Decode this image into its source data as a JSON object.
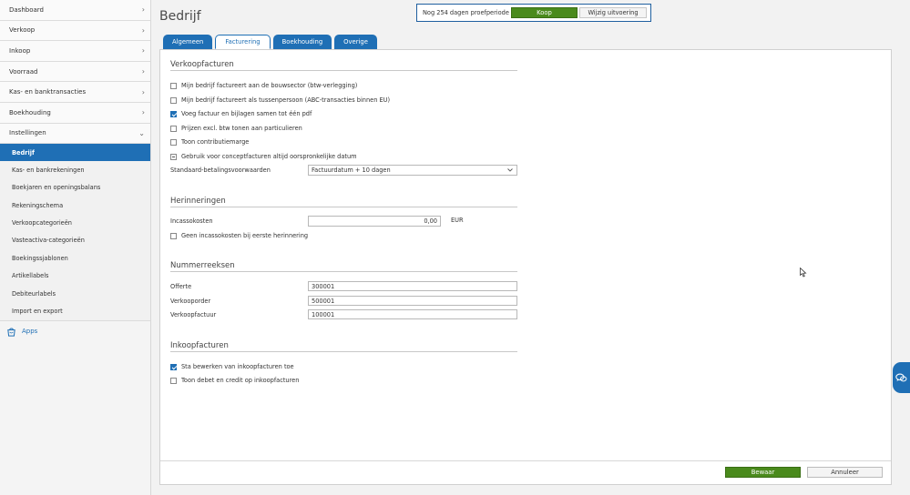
{
  "sidebar": {
    "nav": [
      {
        "label": "Dashboard"
      },
      {
        "label": "Verkoop"
      },
      {
        "label": "Inkoop"
      },
      {
        "label": "Voorraad"
      },
      {
        "label": "Kas- en banktransacties"
      },
      {
        "label": "Boekhouding"
      },
      {
        "label": "Instellingen"
      }
    ],
    "settings_items": [
      {
        "label": "Bedrijf"
      },
      {
        "label": "Kas- en bankrekeningen"
      },
      {
        "label": "Boekjaren en openingsbalans"
      },
      {
        "label": "Rekeningschema"
      },
      {
        "label": "Verkoopcategorieën"
      },
      {
        "label": "Vasteactiva-categorieën"
      },
      {
        "label": "Boekingssjablonen"
      },
      {
        "label": "Artikellabels"
      },
      {
        "label": "Debiteurlabels"
      },
      {
        "label": "Import en export"
      }
    ],
    "apps_label": "Apps"
  },
  "page": {
    "title": "Bedrijf"
  },
  "trial": {
    "text": "Nog 254 dagen proefperiode",
    "buy_label": "Koop",
    "change_label": "Wijzig uitvoering"
  },
  "tabs": [
    {
      "label": "Algemeen",
      "active": false
    },
    {
      "label": "Facturering",
      "active": true
    },
    {
      "label": "Boekhouding",
      "active": false
    },
    {
      "label": "Overige",
      "active": false
    }
  ],
  "sales_invoices": {
    "title": "Verkoopfacturen",
    "options": [
      {
        "label": "Mijn bedrijf factureert aan de bouwsector (btw-verlegging)",
        "state": "unchecked"
      },
      {
        "label": "Mijn bedrijf factureert als tussenpersoon (ABC-transacties binnen EU)",
        "state": "unchecked"
      },
      {
        "label": "Voeg factuur en bijlagen samen tot één pdf",
        "state": "checked"
      },
      {
        "label": "Prijzen excl. btw tonen aan particulieren",
        "state": "unchecked"
      },
      {
        "label": "Toon contributiemarge",
        "state": "unchecked"
      },
      {
        "label": "Gebruik voor conceptfacturen altijd oorspronkelijke datum",
        "state": "indeterminate"
      }
    ],
    "payment_terms_label": "Standaard-betalingsvoorwaarden",
    "payment_terms_value": "Factuurdatum + 10 dagen"
  },
  "reminders": {
    "title": "Herinneringen",
    "collection_costs_label": "Incassokosten",
    "collection_costs_value": "0,00",
    "currency": "EUR",
    "no_costs_first_label": "Geen incassokosten bij eerste herinnering"
  },
  "number_series": {
    "title": "Nummerreeksen",
    "rows": [
      {
        "label": "Offerte",
        "value": "300001"
      },
      {
        "label": "Verkooporder",
        "value": "500001"
      },
      {
        "label": "Verkoopfactuur",
        "value": "100001"
      }
    ]
  },
  "purchase_invoices": {
    "title": "Inkoopfacturen",
    "options": [
      {
        "label": "Sta bewerken van inkoopfacturen toe",
        "state": "checked"
      },
      {
        "label": "Toon debet en credit op inkoopfacturen",
        "state": "unchecked"
      }
    ]
  },
  "footer": {
    "save_label": "Bewaar",
    "cancel_label": "Annuleer"
  },
  "colors": {
    "accent": "#1f6fb5",
    "buy": "#4a8a1c"
  },
  "icons": {
    "nav_chevron": "chevron-right-icon",
    "expanded_chevron": "chevron-down-icon",
    "apps": "shopping-bag-icon",
    "chat": "chat-icon"
  }
}
